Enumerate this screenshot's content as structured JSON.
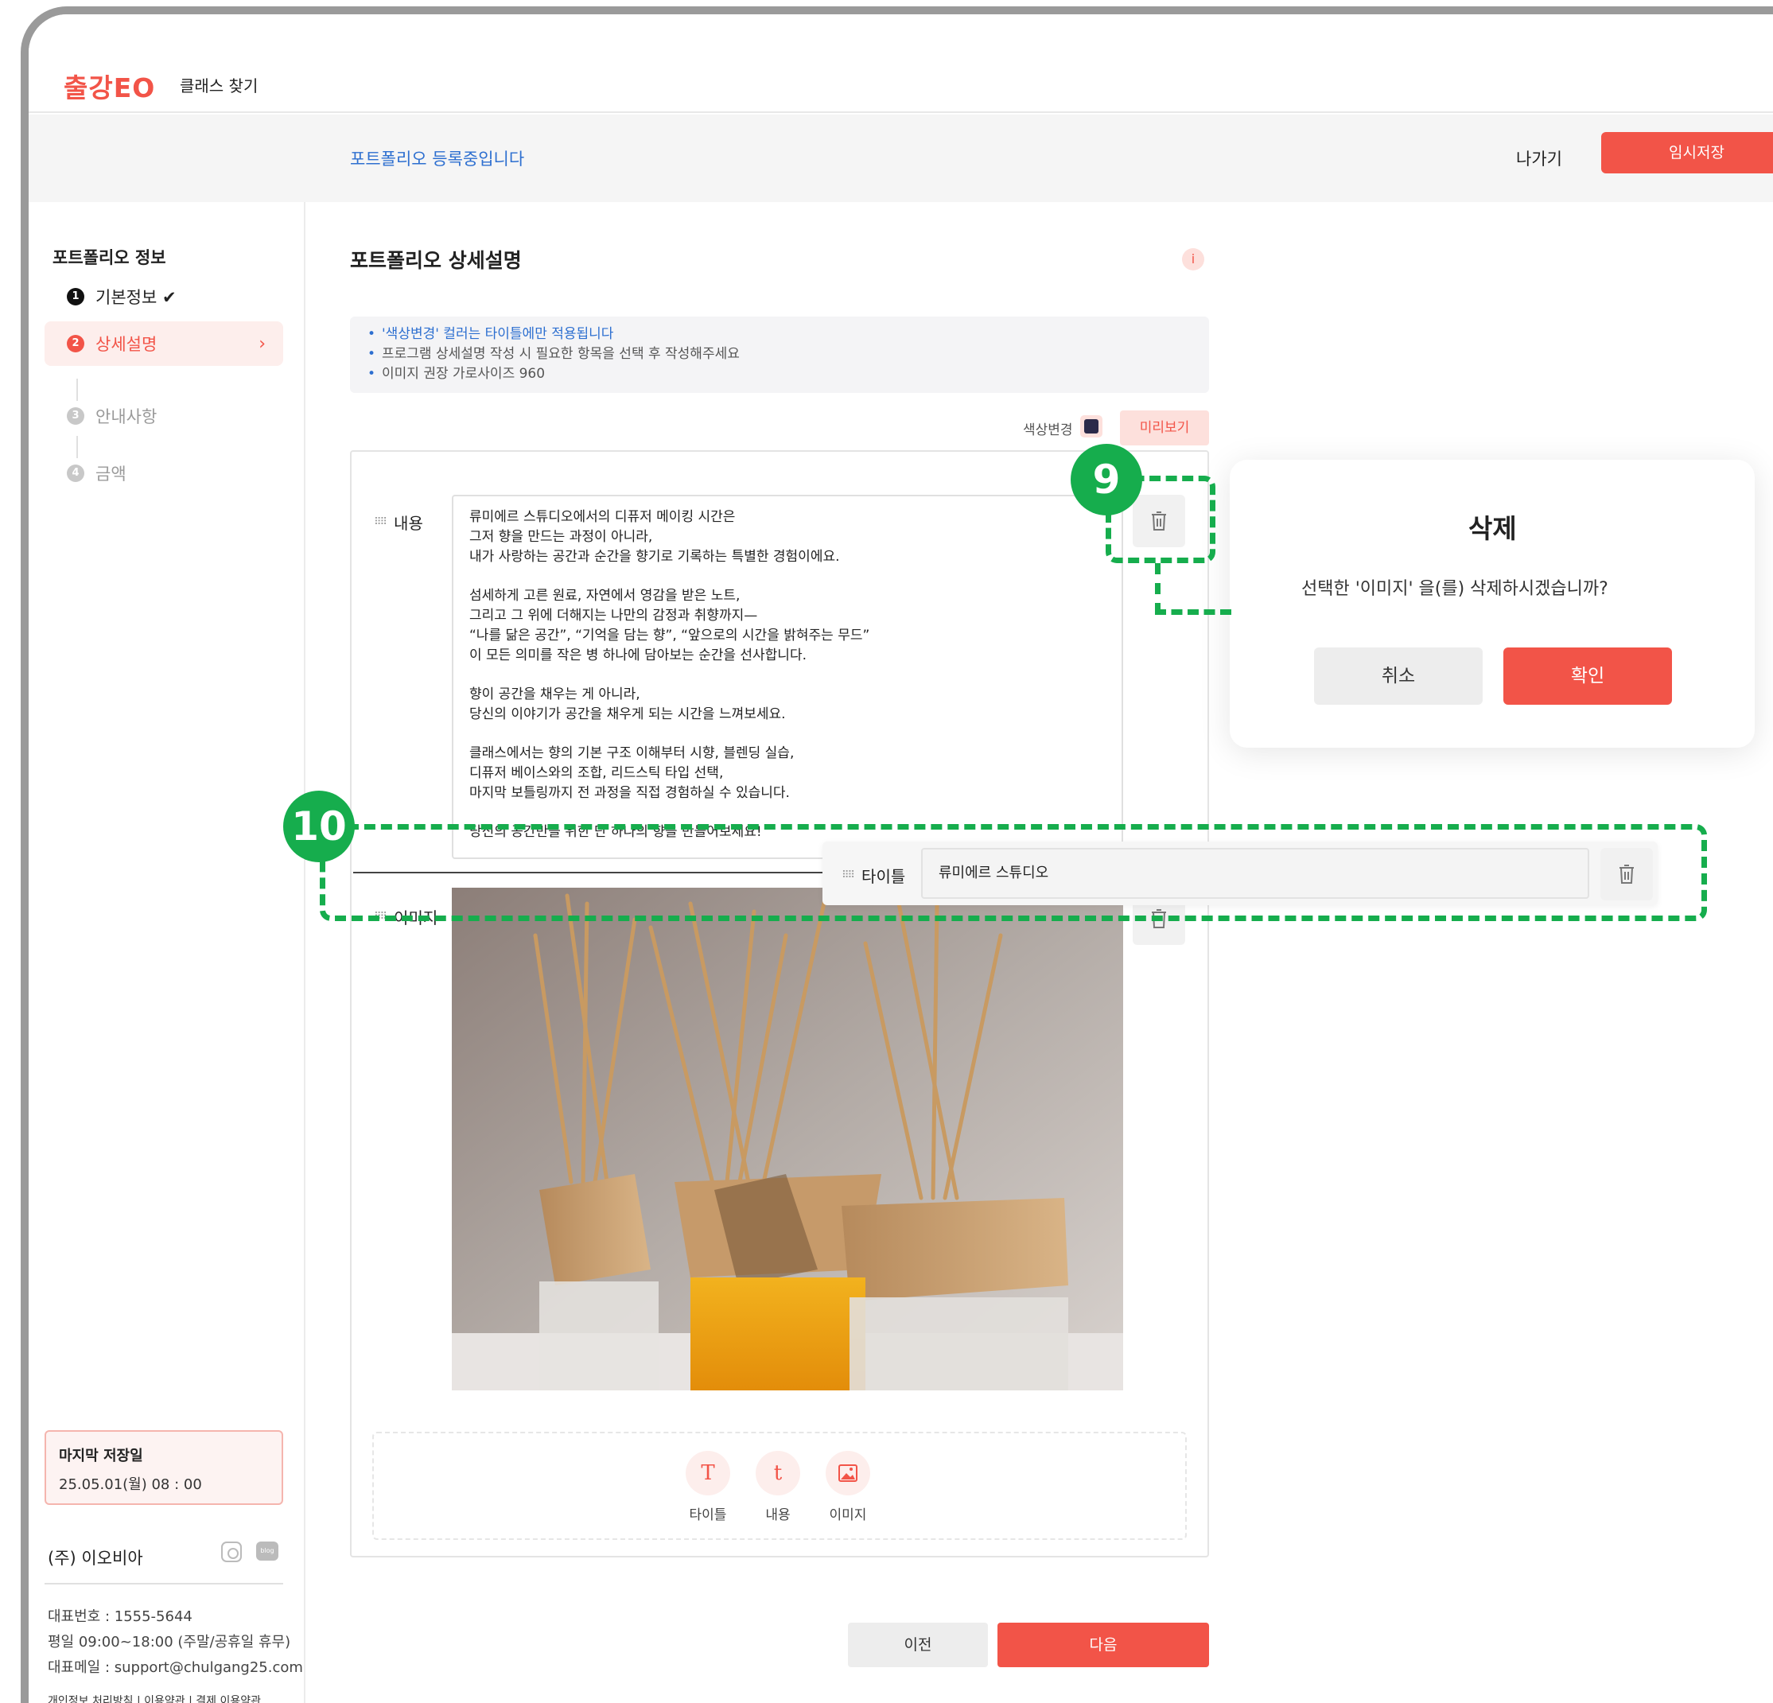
{
  "header": {
    "logo": "출강EO",
    "nav_find_class": "클래스 찾기"
  },
  "subbar": {
    "title": "포트폴리오 등록중입니다",
    "exit": "나가기",
    "temp_save": "임시저장"
  },
  "sidebar": {
    "heading": "포트폴리오 정보",
    "steps": [
      {
        "num": "1",
        "label": "기본정보 ✔"
      },
      {
        "num": "2",
        "label": "상세설명"
      },
      {
        "num": "3",
        "label": "안내사항"
      },
      {
        "num": "4",
        "label": "금액"
      }
    ],
    "last_save_title": "마지막 저장일",
    "last_save_value": "25.05.01(월) 08 : 00",
    "company": "(주) 이오비아",
    "blog_icon_text": "blog",
    "phone": "대표번호 : 1555-5644",
    "hours": "평일 09:00~18:00 (주말/공휴일 휴무)",
    "email": "대표메일 : support@chulgang25.com",
    "footer_links": "개인정보 처리방침 | 이용약관 | 결제 이용약관"
  },
  "main": {
    "title": "포트폴리오 상세설명",
    "info_icon": "i",
    "notices": [
      "'색상변경' 컬러는 타이틀에만 적용됩니다",
      "프로그램 상세설명 작성 시 필요한 항목을 선택 후 작성해주세요",
      "이미지 권장 가로사이즈 960"
    ],
    "color_change": "색상변경",
    "preview": "미리보기",
    "content_label": "내용",
    "content_lines": [
      "류미에르 스튜디오에서의 디퓨저 메이킹 시간은",
      "그저 향을 만드는 과정이 아니라,",
      "내가 사랑하는 공간과 순간을 향기로 기록하는 특별한 경험이에요.",
      "",
      "섬세하게 고른 원료, 자연에서 영감을 받은 노트,",
      "그리고 그 위에 더해지는 나만의 감정과 취향까지—",
      "“나를 닮은 공간”, “기억을 담는 향”, “앞으로의 시간을 밝혀주는 무드”",
      "이 모든 의미를 작은 병 하나에 담아보는 순간을 선사합니다.",
      "",
      "향이 공간을 채우는 게 아니라,",
      "당신의 이야기가 공간을 채우게 되는 시간을 느껴보세요.",
      "",
      "클래스에서는 향의 기본 구조 이해부터 시향, 블렌딩 실습,",
      "디퓨저 베이스와의 조합, 리드스틱 타입 선택,",
      "마지막 보틀링까지 전 과정을 직접 경험하실 수 있습니다.",
      "",
      "당신의 공간만을 위한 단 하나의 향을 만들어보세요!"
    ],
    "image_label": "이미지",
    "title_block_label": "타이틀",
    "title_block_value": "류미에르 스튜디오",
    "add_title": "타이틀",
    "add_content": "내용",
    "add_image": "이미지",
    "add_title_glyph": "T",
    "add_content_glyph": "t",
    "prev": "이전",
    "next": "다음"
  },
  "dialog": {
    "title": "삭제",
    "message": "선택한 '이미지' 을(를) 삭제하시겠습니까?",
    "cancel": "취소",
    "confirm": "확인"
  },
  "annotations": {
    "badge_9": "9",
    "badge_10": "10"
  },
  "colors": {
    "accent": "#f25448",
    "link_blue": "#2d6fd0",
    "annotation_green": "#16ad4d"
  }
}
